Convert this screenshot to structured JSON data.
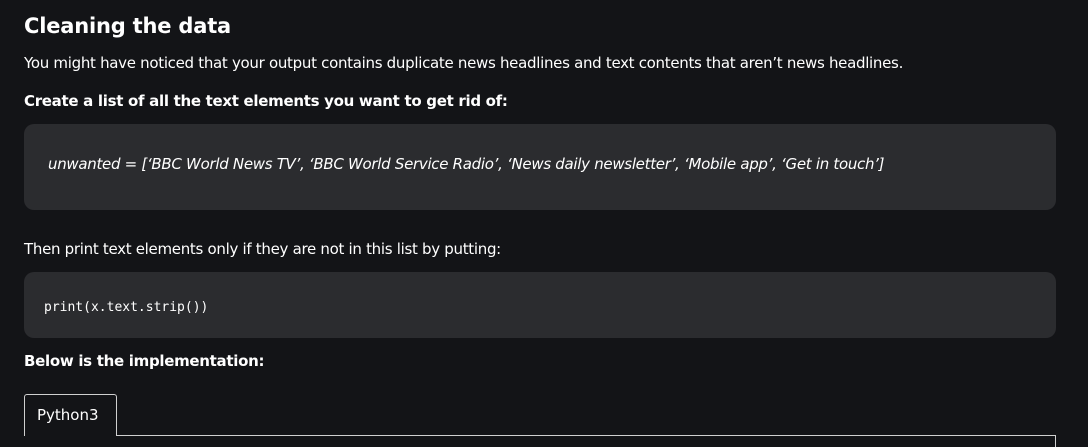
{
  "section": {
    "heading": "Cleaning the data",
    "intro": "You might have noticed that your output contains duplicate news headlines and text contents that aren’t news headlines.",
    "step1": "Create a list of all the text elements you want to get rid of:",
    "quote": "unwanted = [‘BBC World News TV’, ‘BBC World Service Radio’, ‘News daily newsletter’, ‘Mobile app’, ‘Get in touch’]",
    "step2": "Then print text elements only if they are not in this list by putting:",
    "code": "print(x.text.strip())",
    "step3": "Below is the implementation:"
  },
  "code_tabs": [
    {
      "label": "Python3",
      "active": true
    }
  ]
}
